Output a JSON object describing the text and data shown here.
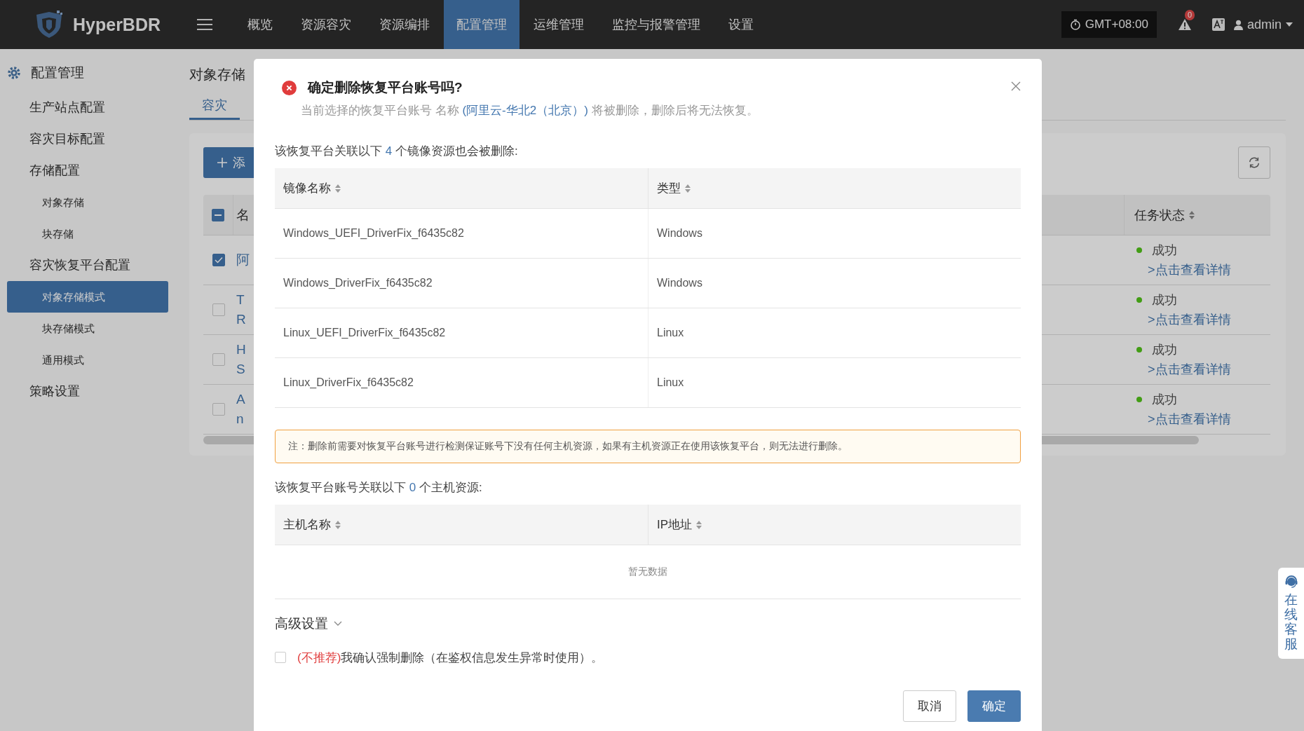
{
  "top_bar": {
    "brand": "HyperBDR",
    "menu": [
      {
        "label": "概览",
        "selected": false
      },
      {
        "label": "资源容灾",
        "selected": false
      },
      {
        "label": "资源编排",
        "selected": false
      },
      {
        "label": "配置管理",
        "selected": true
      },
      {
        "label": "运维管理",
        "selected": false
      },
      {
        "label": "监控与报警管理",
        "selected": false
      },
      {
        "label": "设置",
        "selected": false
      }
    ],
    "timezone": "GMT+08:00",
    "alert_count": "0",
    "user": "admin"
  },
  "sidebar": {
    "title": "配置管理",
    "items": [
      {
        "label": "生产站点配置",
        "selected": false
      },
      {
        "label": "容灾目标配置",
        "selected": false
      },
      {
        "label": "存储配置",
        "selected": false,
        "children": [
          {
            "label": "对象存储",
            "selected": false
          },
          {
            "label": "块存储",
            "selected": false
          }
        ]
      },
      {
        "label": "容灾恢复平台配置",
        "selected": false,
        "children": [
          {
            "label": "对象存储模式",
            "selected": true
          },
          {
            "label": "块存储模式",
            "selected": false
          },
          {
            "label": "通用模式",
            "selected": false
          }
        ]
      },
      {
        "label": "策略设置",
        "selected": false
      }
    ]
  },
  "page": {
    "title": "对象存储",
    "tabs": [
      {
        "label": "容灾",
        "selected": true
      }
    ],
    "add_button": "添",
    "table": {
      "header_checkbox": {
        "indeterminate": true
      },
      "columns": [
        "名",
        "任务状态"
      ],
      "rows": [
        {
          "checked": true,
          "name": [
            "阿"
          ],
          "status": "成功",
          "color": "#429d15",
          "link": ">点击查看详情"
        },
        {
          "checked": false,
          "name": [
            "T",
            "R"
          ],
          "status": "成功",
          "color": "#429d15",
          "link": ">点击查看详情"
        },
        {
          "checked": false,
          "name": [
            "H",
            "S"
          ],
          "status": "成功",
          "color": "#429d15",
          "link": ">点击查看详情"
        },
        {
          "checked": false,
          "name": [
            "A",
            "n"
          ],
          "status": "成功",
          "color": "#429d15",
          "link": ">点击查看详情"
        }
      ]
    }
  },
  "dialog": {
    "title": "确定删除恢复平台账号吗?",
    "description": {
      "prefix": "当前选择的恢复平台账号 名称 ",
      "link": "(阿里云-华北2（北京）)",
      "suffix": " 将被删除，删除后将无法恢复。"
    },
    "images_intro": {
      "prefix": "该恢复平台关联以下 ",
      "count": "4",
      "suffix": " 个镜像资源也会被删除:"
    },
    "images_table": {
      "columns": [
        "镜像名称",
        "类型"
      ],
      "rows": [
        [
          "Windows_UEFI_DriverFix_f6435c82",
          "Windows"
        ],
        [
          "Windows_DriverFix_f6435c82",
          "Windows"
        ],
        [
          "Linux_UEFI_DriverFix_f6435c82",
          "Linux"
        ],
        [
          "Linux_DriverFix_f6435c82",
          "Linux"
        ]
      ]
    },
    "notice": "注：删除前需要对恢复平台账号进行检测保证账号下没有任何主机资源，如果有主机资源正在使用该恢复平台，则无法进行删除。",
    "hosts_intro": {
      "prefix": "该恢复平台账号关联以下 ",
      "count": "0",
      "suffix": " 个主机资源:"
    },
    "hosts_table": {
      "columns": [
        "主机名称",
        "IP地址"
      ],
      "empty_text": "暂无数据"
    },
    "advanced": {
      "label": "高级设置",
      "expanded": false
    },
    "force_delete": {
      "checked": false,
      "warning": "(不推荐)",
      "label": "我确认强制删除（在鉴权信息发生异常时使用）。"
    },
    "buttons": [
      {
        "label": "取消",
        "kind": "secondary"
      },
      {
        "label": "确定",
        "kind": "primary"
      }
    ]
  },
  "support_widget": {
    "label": "在线客服"
  }
}
